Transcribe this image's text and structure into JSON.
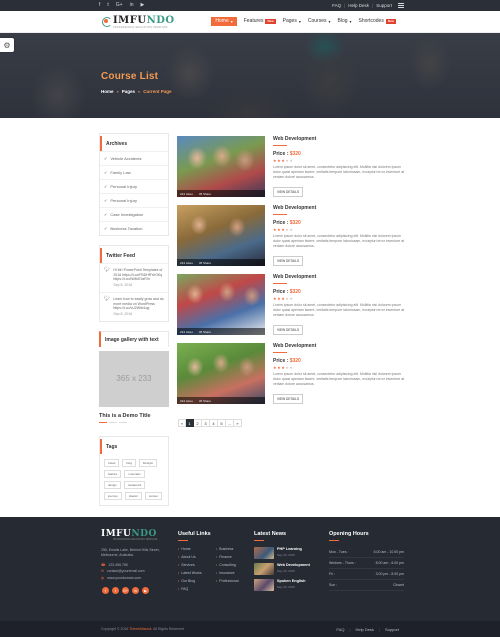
{
  "topbar": {
    "social": [
      "f",
      "t",
      "G+",
      "in",
      "▶"
    ],
    "links": [
      "FAQ",
      "Help Desk",
      "Support"
    ]
  },
  "brand": {
    "name_a": "IMFU",
    "name_b": "NDO",
    "tagline": "PROFESSIONAL EDUCATION TEMPLATE"
  },
  "nav": [
    {
      "label": "Home",
      "active": true,
      "caret": true
    },
    {
      "label": "Features",
      "badge": "New",
      "caret": false
    },
    {
      "label": "Pages",
      "caret": true
    },
    {
      "label": "Courses",
      "caret": true
    },
    {
      "label": "Blog",
      "caret": true
    },
    {
      "label": "Shortcodes",
      "badge": "New",
      "caret": false
    }
  ],
  "hero": {
    "title": "Course List",
    "crumbs": [
      "Home",
      "Pages",
      "Current Page"
    ]
  },
  "sidebar": {
    "archives": {
      "title": "Archives",
      "items": [
        "Vehicle Accidents",
        "Family Law",
        "Personal Injury",
        "Personal Injury",
        "Case Investigation",
        "Business Taxation"
      ]
    },
    "twitter": {
      "title": "Twitter Feed",
      "tweets": [
        {
          "text": "Hi Mr! PowerPoint Templates of 2016 https://t.co/FBDHRYeOKq https://t.co/tW8d7bzRXr",
          "date": "Sep 8, 2016"
        },
        {
          "text": "Learn how to easily grow and do more media on WordPress https://t.co/vU2Wlxt1qq",
          "date": "Sep 8, 2016"
        }
      ]
    },
    "gallery": {
      "title": "Image gallery with text",
      "placeholder": "365 x 233",
      "caption": "This is a Demo Title"
    },
    "tags": {
      "title": "Tags",
      "items": [
        "travel",
        "blog",
        "lifestyle",
        "feature",
        "mountain",
        "design",
        "restaurant",
        "journey",
        "classic",
        "sunset"
      ]
    }
  },
  "courses": [
    {
      "title": "Web Development",
      "price_label": "Price :",
      "price": "$320",
      "rating": 3,
      "likes": "224 Likes",
      "shares": "45 Share",
      "desc": "Lorem ipsum dolor sit amet, consectetur adipisicing elit. Mollitia nisi dolorem ipsum dolor quasi aperiam facere, veritatis tempore laboriosam, excepturi error inventore at veniam dolore accusamus.",
      "button": "VIEW DETAILS"
    },
    {
      "title": "Web Development",
      "price_label": "Price :",
      "price": "$320",
      "rating": 3,
      "likes": "224 Likes",
      "shares": "45 Share",
      "desc": "Lorem ipsum dolor sit amet, consectetur adipisicing elit. Mollitia nisi dolorem ipsum dolor quasi aperiam facere, veritatis tempore laboriosam, excepturi error inventore at veniam dolore accusamus.",
      "button": "VIEW DETAILS"
    },
    {
      "title": "Web Development",
      "price_label": "Price :",
      "price": "$320",
      "rating": 3,
      "likes": "224 Likes",
      "shares": "45 Share",
      "desc": "Lorem ipsum dolor sit amet, consectetur adipisicing elit. Mollitia nisi dolorem ipsum dolor quasi aperiam facere, veritatis tempore laboriosam, excepturi error inventore at veniam dolore accusamus.",
      "button": "VIEW DETAILS"
    },
    {
      "title": "Web Development",
      "price_label": "Price :",
      "price": "$320",
      "rating": 3,
      "likes": "224 Likes",
      "shares": "45 Share",
      "desc": "Lorem ipsum dolor sit amet, consectetur adipisicing elit. Mollitia nisi dolorem ipsum dolor quasi aperiam facere, veritatis tempore laboriosam, excepturi error inventore at veniam dolore accusamus.",
      "button": "VIEW DETAILS"
    }
  ],
  "pagination": {
    "prev": "«",
    "pages": [
      "1",
      "2",
      "3",
      "4",
      "5",
      "..."
    ],
    "next": "»",
    "current": "1"
  },
  "footer": {
    "address": "255, Emails Lake, Behind Hills Street, Melbourne, Australia.",
    "phone": "123.456.789",
    "email": "contact@youremail.com",
    "web": "www.yourdomain.com",
    "social": [
      "f",
      "t",
      "G+",
      "in",
      "▶"
    ],
    "useful": {
      "title": "Useful Links",
      "items": [
        "Home",
        "Business",
        "About Us",
        "Finance",
        "Services",
        "Consulting",
        "Latest Works",
        "Insurance",
        "Our Blog",
        "Professional",
        "FAQ"
      ]
    },
    "news": {
      "title": "Latest News",
      "items": [
        {
          "title": "PHP Learning",
          "date": "Sep 26, 2015"
        },
        {
          "title": "Web Development",
          "date": "Sep 26, 2015"
        },
        {
          "title": "Spoken English",
          "date": "Sep 26, 2015"
        }
      ]
    },
    "hours": {
      "title": "Opening Hours",
      "rows": [
        {
          "day": "Mon - Tues :",
          "time": "6.00 am - 10.00 pm"
        },
        {
          "day": "Wednes - Thurs :",
          "time": "8.00 am - 6.00 pm"
        },
        {
          "day": "Fri :",
          "time": "3.00 pm - 8.00 pm"
        },
        {
          "day": "Sun :",
          "time": "Closed"
        }
      ]
    },
    "copyright_a": "Copyright © 2016 ",
    "copyright_brand": "ThemeMascot",
    "copyright_b": ". All Rights Reserved",
    "bottom_links": [
      "FAQ",
      "Help Desk",
      "Support"
    ]
  }
}
